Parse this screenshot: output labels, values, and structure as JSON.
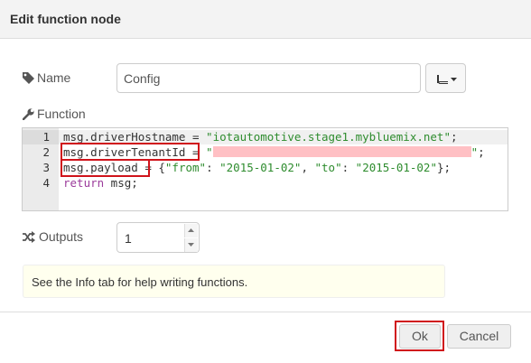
{
  "dialog": {
    "title": "Edit function node"
  },
  "name_field": {
    "label": "Name",
    "value": "Config"
  },
  "function_field": {
    "label": "Function",
    "lines": [
      {
        "number": "1",
        "tokens": [
          {
            "t": "msg.driverHostname",
            "c": "v"
          },
          {
            "t": " = ",
            "c": "o"
          },
          {
            "t": "\"iotautomotive.stage1.mybluemix.net\"",
            "c": "s"
          },
          {
            "t": ";",
            "c": "p"
          }
        ]
      },
      {
        "number": "2",
        "tokens": [
          {
            "t": "msg.driverTenantId",
            "c": "v"
          },
          {
            "t": " = ",
            "c": "o"
          },
          {
            "t": "\"",
            "c": "s"
          },
          {
            "t": "",
            "c": "redacted"
          },
          {
            "t": "\"",
            "c": "s"
          },
          {
            "t": ";",
            "c": "p"
          }
        ]
      },
      {
        "number": "3",
        "tokens": [
          {
            "t": "msg.payload",
            "c": "v"
          },
          {
            "t": " = ",
            "c": "o"
          },
          {
            "t": "{",
            "c": "p"
          },
          {
            "t": "\"from\"",
            "c": "s"
          },
          {
            "t": ": ",
            "c": "p"
          },
          {
            "t": "\"2015-01-02\"",
            "c": "s"
          },
          {
            "t": ", ",
            "c": "p"
          },
          {
            "t": "\"to\"",
            "c": "s"
          },
          {
            "t": ": ",
            "c": "p"
          },
          {
            "t": "\"2015-01-02\"",
            "c": "s"
          },
          {
            "t": "};",
            "c": "p"
          }
        ]
      },
      {
        "number": "4",
        "tokens": [
          {
            "t": "return",
            "c": "k"
          },
          {
            "t": " msg;",
            "c": "v"
          }
        ]
      }
    ]
  },
  "outputs_field": {
    "label": "Outputs",
    "value": "1"
  },
  "tip": {
    "text": "See the Info tab for help writing functions."
  },
  "buttons": {
    "ok": "Ok",
    "cancel": "Cancel"
  },
  "colors": {
    "highlight_box": "#d0131b",
    "string": "#2e8c2e",
    "keyword": "#9b3b9b",
    "redaction": "#ffc0c4"
  },
  "icons": [
    "tag-icon",
    "wrench-icon",
    "shuffle-icon",
    "book-icon",
    "caret-down-icon"
  ]
}
